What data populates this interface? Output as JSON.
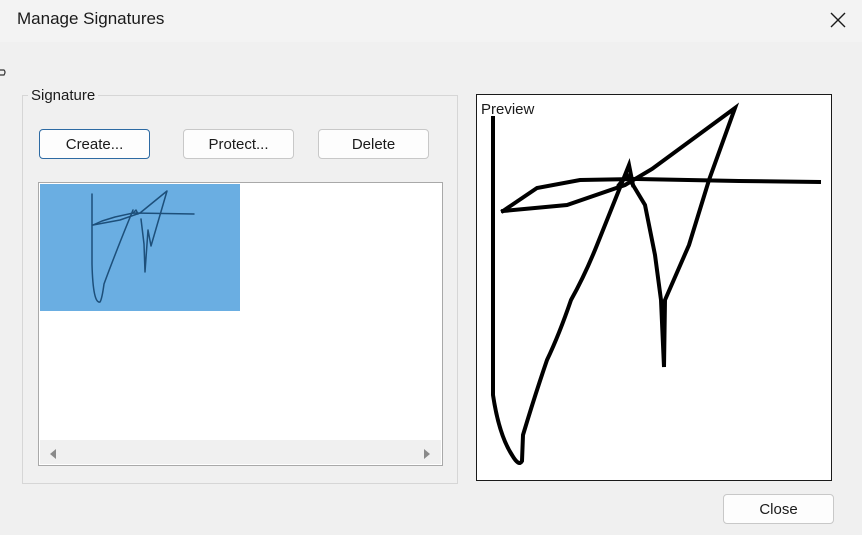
{
  "window": {
    "title": "Manage Signatures"
  },
  "signature_group": {
    "label": "Signature",
    "buttons": {
      "create": "Create...",
      "protect": "Protect...",
      "delete": "Delete"
    }
  },
  "signature_list": {
    "selected_index": 0,
    "items": [
      {
        "selected": true
      }
    ]
  },
  "preview": {
    "label": "Preview"
  },
  "footer": {
    "close": "Close"
  },
  "colors": {
    "selection": "#6aaee2",
    "primary_border": "#2d6aa3",
    "ink": "#000000"
  },
  "icons": {
    "close": "close-icon",
    "scroll_left": "scroll-left-arrow-icon",
    "scroll_right": "scroll-right-arrow-icon"
  }
}
